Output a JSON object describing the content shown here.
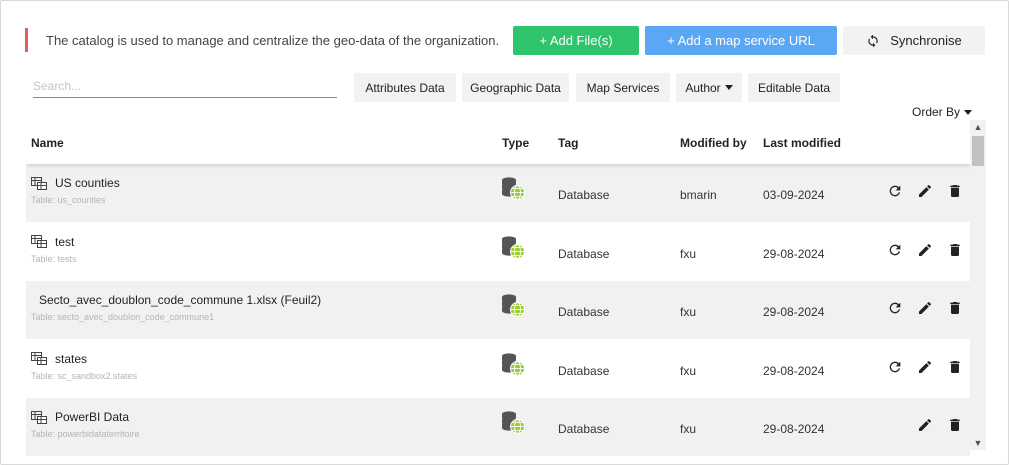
{
  "banner": {
    "info_text": "The catalog is used to manage and centralize the geo-data of the organization.",
    "accent_color": "#e0605f"
  },
  "toolbar": {
    "add_file_label": "+ Add File(s)",
    "add_map_label": "+ Add a map service URL",
    "sync_label": "Synchronise",
    "add_file_color": "#2fc46b",
    "add_map_color": "#5aa7f5"
  },
  "search": {
    "placeholder": "Search...",
    "value": ""
  },
  "filters": [
    {
      "label": "Attributes Data"
    },
    {
      "label": "Geographic Data"
    },
    {
      "label": "Map Services"
    },
    {
      "label": "Author"
    },
    {
      "label": "Editable Data"
    }
  ],
  "order_by_label": "Order By",
  "table": {
    "columns": [
      "Name",
      "Type",
      "Tag",
      "Modified by",
      "Last modified"
    ],
    "rows": [
      {
        "name": "US counties",
        "subtitle": "Table: us_counties",
        "tag": "Database",
        "modified_by": "bmarin",
        "last_modified": "03-09-2024",
        "has_table_icon": true,
        "has_refresh": true
      },
      {
        "name": "test",
        "subtitle": "Table: tests",
        "tag": "Database",
        "modified_by": "fxu",
        "last_modified": "29-08-2024",
        "has_table_icon": true,
        "has_refresh": true
      },
      {
        "name": "Secto_avec_doublon_code_commune 1.xlsx (Feuil2)",
        "subtitle": "Table: secto_avec_doublon_code_commune1",
        "tag": "Database",
        "modified_by": "fxu",
        "last_modified": "29-08-2024",
        "has_table_icon": false,
        "has_refresh": true
      },
      {
        "name": "states",
        "subtitle": "Table: sc_sandbox2.states",
        "tag": "Database",
        "modified_by": "fxu",
        "last_modified": "29-08-2024",
        "has_table_icon": true,
        "has_refresh": true
      },
      {
        "name": "PowerBI Data",
        "subtitle": "Table: powerbidataterritoire",
        "tag": "Database",
        "modified_by": "fxu",
        "last_modified": "29-08-2024",
        "has_table_icon": true,
        "has_refresh": false
      }
    ]
  },
  "icons": {
    "type": "database-globe-icon",
    "row_table": "table-icon",
    "refresh": "refresh-icon",
    "edit": "pencil-icon",
    "delete": "trash-icon",
    "sync": "sync-icon"
  }
}
